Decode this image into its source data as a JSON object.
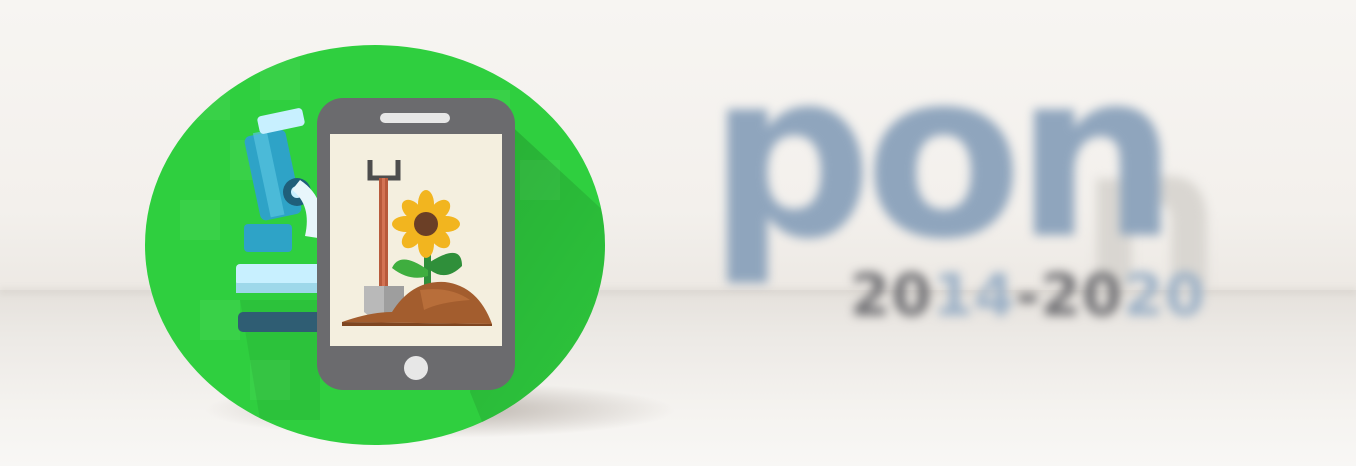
{
  "logo": {
    "word": "pon",
    "years_part1": "20",
    "years_part2": "14",
    "years_part3": "-20",
    "years_part4": "20"
  },
  "colors": {
    "circle_green": "#2fcf3f",
    "phone_body": "#6b6b6e",
    "screen_bg": "#f4efdf",
    "microscope_blue": "#2ea3c7",
    "dirt_brown": "#a35d2e",
    "logo_blue": "#8fa5bd",
    "logo_gray": "#6f6f73"
  },
  "icons": [
    "microscope-icon",
    "smartphone-icon",
    "shovel-icon",
    "sunflower-icon",
    "soil-mound-icon"
  ]
}
